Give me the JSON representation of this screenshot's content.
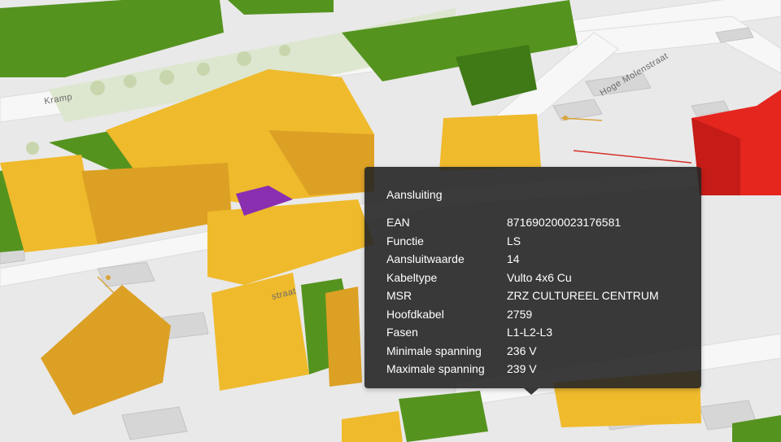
{
  "map": {
    "street_labels": [
      "Kramp",
      "straat",
      "Hoge Molenstraat"
    ],
    "colors": {
      "ground": "#e9e9e9",
      "road": "#f7f7f7",
      "park": "#dde6cf",
      "building_green_top": "#55931f",
      "building_green_side": "#3f7a16",
      "building_yellow_top": "#efba2c",
      "building_yellow_side": "#dca024",
      "building_red_top": "#e4261f",
      "building_red_side": "#c51c17",
      "building_purple": "#8a2fb0",
      "grey_building": "#d6d6d6"
    }
  },
  "popup": {
    "title": "Aansluiting",
    "rows": [
      {
        "label": "EAN",
        "value": "871690200023176581"
      },
      {
        "label": "Functie",
        "value": "LS"
      },
      {
        "label": "Aansluitwaarde",
        "value": "14"
      },
      {
        "label": "Kabeltype",
        "value": "Vulto 4x6 Cu"
      },
      {
        "label": "MSR",
        "value": "ZRZ CULTUREEL CENTRUM"
      },
      {
        "label": "Hoofdkabel",
        "value": "2759"
      },
      {
        "label": "Fasen",
        "value": "L1-L2-L3"
      },
      {
        "label": "Minimale spanning",
        "value": "236 V"
      },
      {
        "label": "Maximale spanning",
        "value": "239 V"
      }
    ]
  }
}
